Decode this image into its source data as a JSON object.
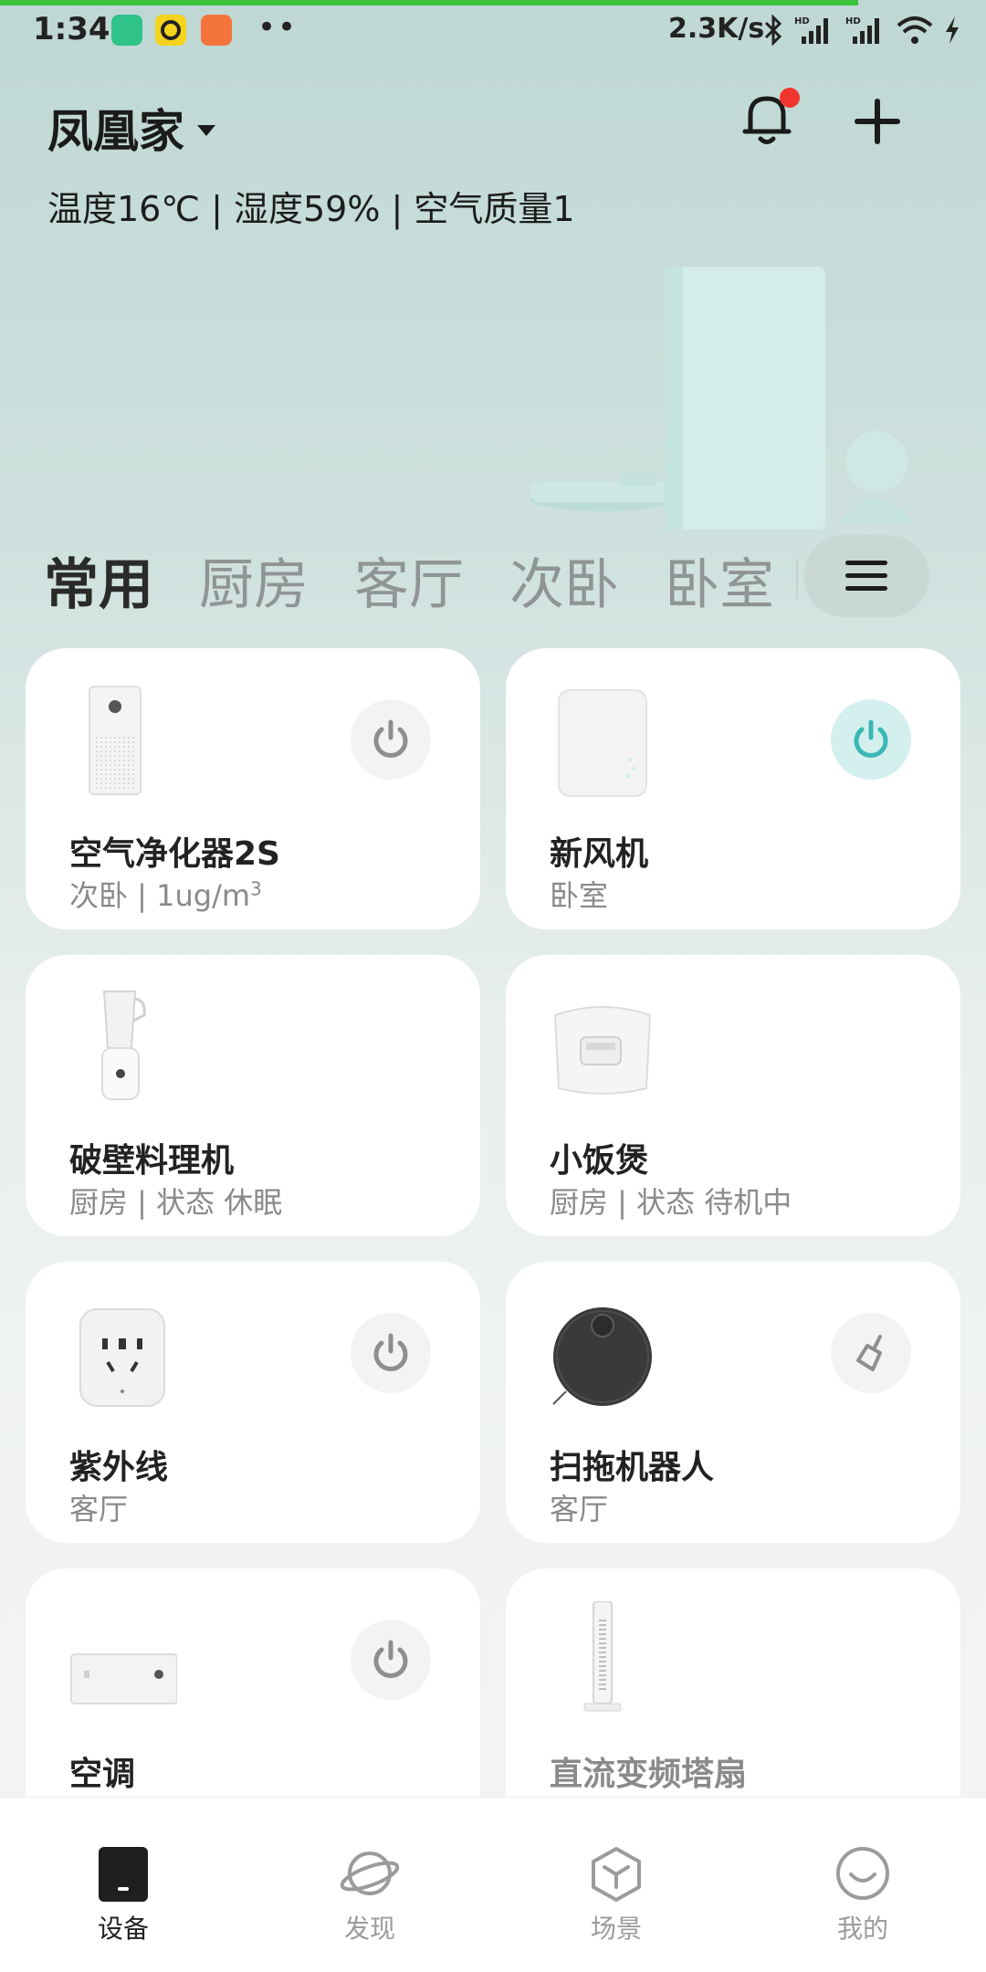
{
  "status_bar": {
    "time": "1:34",
    "dots": "••",
    "net_speed": "2.3K/s",
    "icons": [
      "bluetooth-icon",
      "hd-signal-icon",
      "hd-signal-icon",
      "wifi-icon",
      "charging-icon"
    ]
  },
  "header": {
    "home_name": "凤凰家",
    "environment": "温度16℃ | 湿度59% | 空气质量1",
    "notification_badge": true
  },
  "tabs": [
    {
      "label": "常用",
      "active": true
    },
    {
      "label": "厨房",
      "active": false
    },
    {
      "label": "客厅",
      "active": false
    },
    {
      "label": "次卧",
      "active": false
    },
    {
      "label": "卧室",
      "active": false
    }
  ],
  "devices": [
    {
      "name": "空气净化器2S",
      "sub": "次卧 | 1ug/m",
      "sub_sup": "3",
      "control": "power",
      "on": false
    },
    {
      "name": "新风机",
      "sub": "卧室",
      "control": "power",
      "on": true
    },
    {
      "name": "破壁料理机",
      "sub": "厨房 | 状态 休眠",
      "control": "none"
    },
    {
      "name": "小饭煲",
      "sub": "厨房 | 状态 待机中",
      "control": "none"
    },
    {
      "name": "紫外线",
      "sub": "客厅",
      "control": "power",
      "on": false
    },
    {
      "name": "扫拖机器人",
      "sub": "客厅",
      "control": "sweep"
    },
    {
      "name": "空调",
      "sub": "",
      "control": "power",
      "on": false
    },
    {
      "name": "直流变频塔扇",
      "sub": "",
      "control": "none"
    }
  ],
  "bottom_nav": [
    {
      "label": "设备",
      "icon": "device-icon",
      "active": true
    },
    {
      "label": "发现",
      "icon": "planet-icon",
      "active": false
    },
    {
      "label": "场景",
      "icon": "scene-cube-icon",
      "active": false
    },
    {
      "label": "我的",
      "icon": "smile-icon",
      "active": false
    }
  ],
  "colors": {
    "accent": "#3cb8b4",
    "badge": "#f2362f",
    "progress": "#3cc43c",
    "background_top": "#bfd8d4"
  }
}
